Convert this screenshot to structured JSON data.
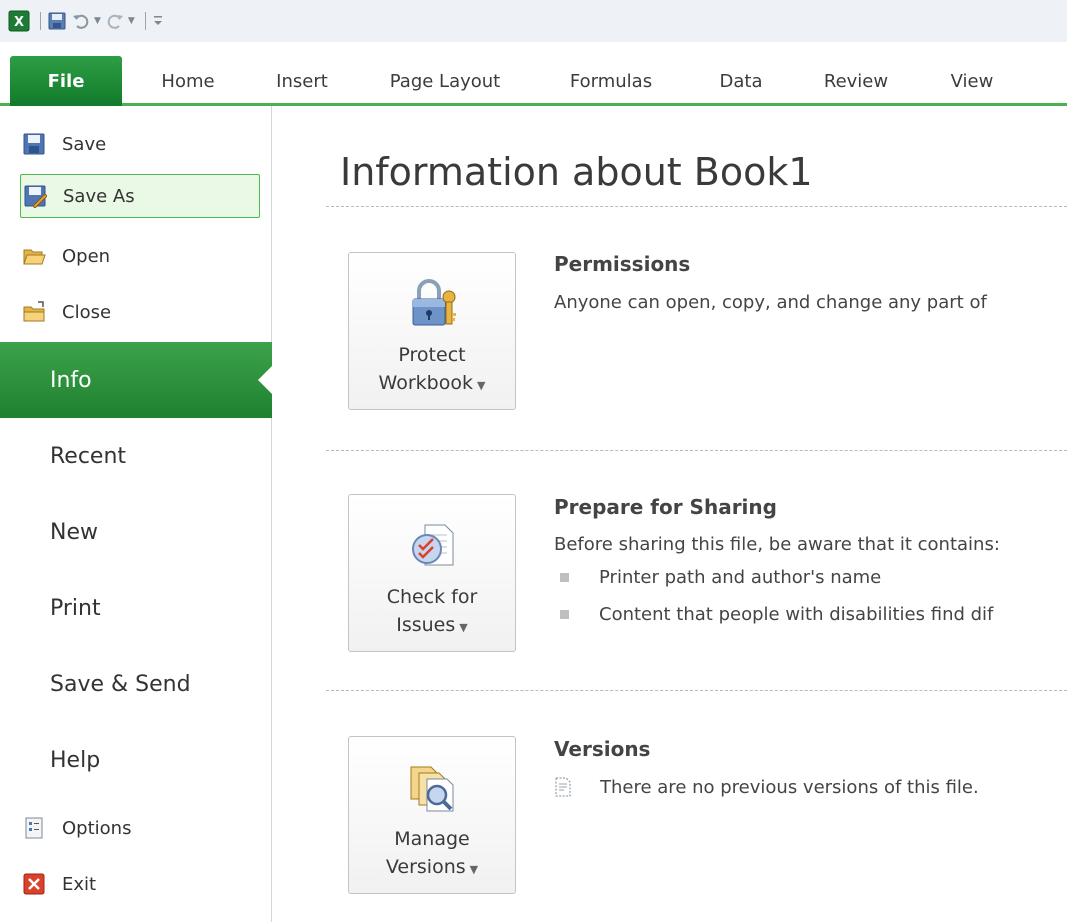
{
  "qat": {
    "icons": [
      "excel-logo-icon",
      "save-icon",
      "undo-icon",
      "redo-icon",
      "customize-qat-icon"
    ]
  },
  "tabs": [
    {
      "label": "File"
    },
    {
      "label": "Home"
    },
    {
      "label": "Insert"
    },
    {
      "label": "Page Layout"
    },
    {
      "label": "Formulas"
    },
    {
      "label": "Data"
    },
    {
      "label": "Review"
    },
    {
      "label": "View"
    }
  ],
  "nav": {
    "commands": [
      {
        "label": "Save",
        "icon": "save-icon"
      },
      {
        "label": "Save As",
        "icon": "save-as-icon"
      },
      {
        "label": "Open",
        "icon": "open-folder-icon"
      },
      {
        "label": "Close",
        "icon": "close-folder-icon"
      }
    ],
    "items": [
      {
        "label": "Info"
      },
      {
        "label": "Recent"
      },
      {
        "label": "New"
      },
      {
        "label": "Print"
      },
      {
        "label": "Save & Send"
      },
      {
        "label": "Help"
      }
    ],
    "bottom": [
      {
        "label": "Options",
        "icon": "options-icon"
      },
      {
        "label": "Exit",
        "icon": "exit-icon"
      }
    ]
  },
  "main": {
    "title": "Information about Book1",
    "sections": [
      {
        "button_line1": "Protect",
        "button_line2": "Workbook",
        "title": "Permissions",
        "desc": "Anyone can open, copy, and change any part of"
      },
      {
        "button_line1": "Check for",
        "button_line2": "Issues",
        "title": "Prepare for Sharing",
        "desc": "Before sharing this file, be aware that it contains:",
        "bullets": [
          "Printer path and author's name",
          "Content that people with disabilities find dif"
        ]
      },
      {
        "button_line1": "Manage",
        "button_line2": "Versions",
        "title": "Versions",
        "desc": "There are no previous versions of this file."
      }
    ]
  },
  "colors": {
    "accent": "#1e8130",
    "tab_border": "#4caf50",
    "qat_bg": "#eef1f5"
  }
}
